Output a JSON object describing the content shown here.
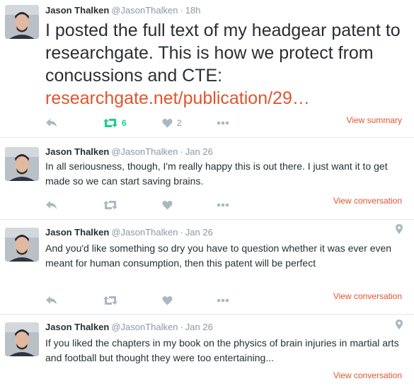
{
  "tweets": [
    {
      "name": "Jason Thalken",
      "handle": "@JasonThalken",
      "separator": "·",
      "time": "18h",
      "text": "I posted the full text of my headgear patent to researchgate. This is how we protect from concussions and CTE:",
      "link": "researchgate.net/publication/29…",
      "retweets": "6",
      "likes": "2",
      "context_link": "View summary"
    },
    {
      "name": "Jason Thalken",
      "handle": "@JasonThalken",
      "separator": "·",
      "time": "Jan 26",
      "text": "In all seriousness, though, I'm really happy this is out there. I just want it to get made so we can start saving brains.",
      "context_link": "View conversation"
    },
    {
      "name": "Jason Thalken",
      "handle": "@JasonThalken",
      "separator": "·",
      "time": "Jan 26",
      "text": "And you'd like something so dry you have to question whether it was ever even meant for human consumption, then this patent will be perfect",
      "context_link": "View conversation"
    },
    {
      "name": "Jason Thalken",
      "handle": "@JasonThalken",
      "separator": "·",
      "time": "Jan 26",
      "text": "If you liked the chapters in my book on the physics of brain injuries in martial arts and football but thought they were too entertaining...",
      "context_link": "View conversation"
    }
  ],
  "colors": {
    "accent_link": "#e0542d",
    "retweet_green": "#19cf86",
    "muted": "#8899a6",
    "text": "#292f33",
    "divider": "#e1e8ed"
  },
  "icons": [
    "reply-icon",
    "retweet-icon",
    "like-icon",
    "more-icon",
    "location-pin-icon"
  ]
}
